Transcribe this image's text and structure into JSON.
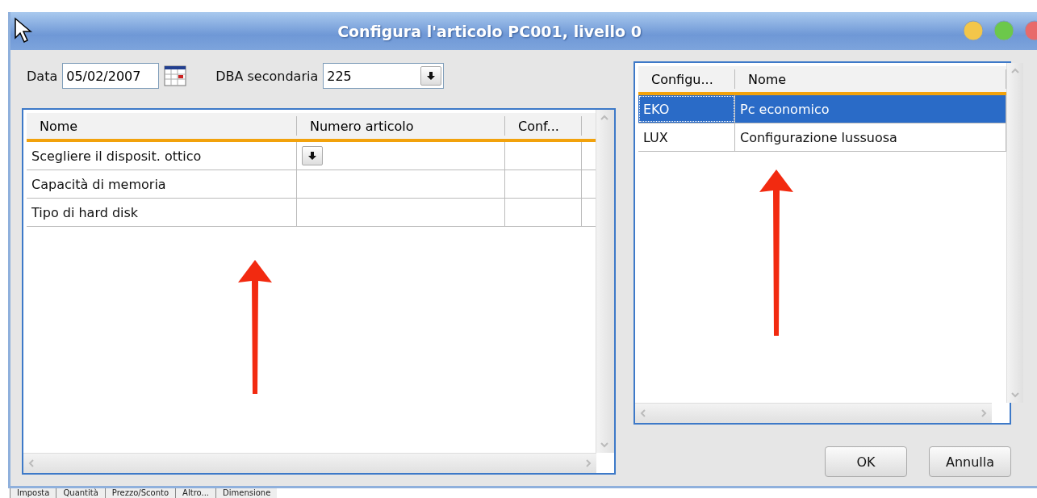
{
  "window": {
    "title": "Configura l'articolo PC001, livello 0"
  },
  "filters": {
    "date_label": "Data",
    "date_value": "05/02/2007",
    "dba_label": "DBA secondaria",
    "dba_value": "225"
  },
  "options_table": {
    "columns": [
      "Nome",
      "Numero articolo",
      "Conf..."
    ],
    "rows": [
      {
        "name": "Scegliere il disposit. ottico",
        "number": "",
        "conf": "",
        "has_dropdown": true
      },
      {
        "name": "Capacità di memoria",
        "number": "",
        "conf": "",
        "has_dropdown": false
      },
      {
        "name": "Tipo di hard disk",
        "number": "",
        "conf": "",
        "has_dropdown": false
      }
    ]
  },
  "config_table": {
    "columns": [
      "Configu...",
      "Nome"
    ],
    "rows": [
      {
        "code": "EKO",
        "name": "Pc economico",
        "selected": true
      },
      {
        "code": "LUX",
        "name": "Configurazione lussuosa",
        "selected": false
      }
    ]
  },
  "buttons": [
    "OK",
    "Annulla"
  ],
  "background_tabs": [
    "Imposta",
    "Quantità",
    "Prezzo/Sconto",
    "Altro...",
    "Dimensione"
  ]
}
